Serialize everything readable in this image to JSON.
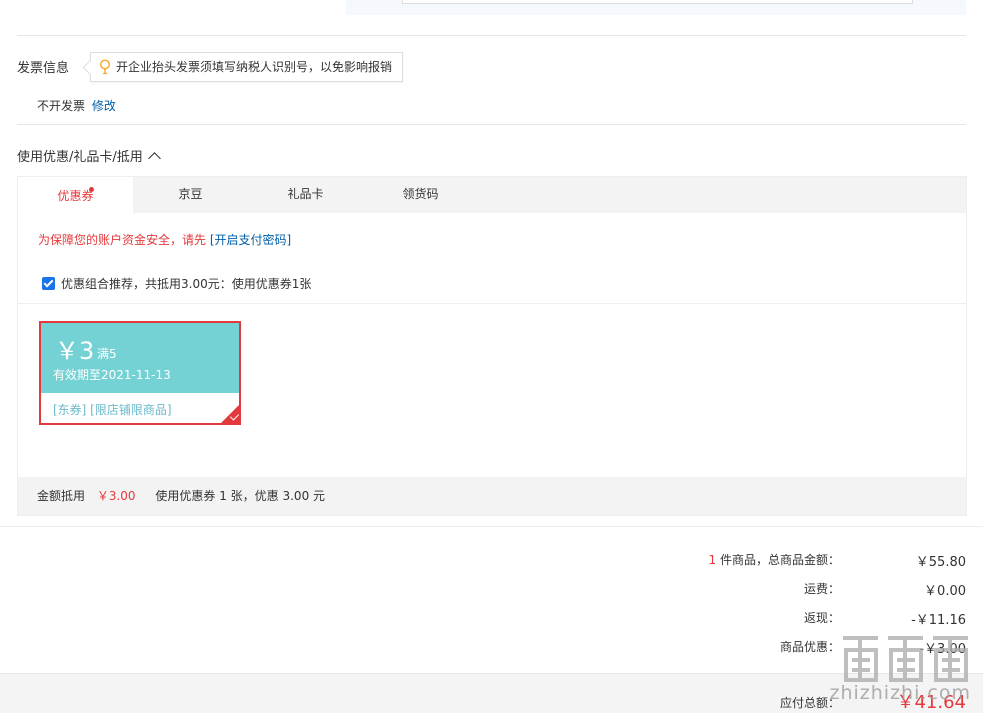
{
  "invoice": {
    "title": "发票信息",
    "tip": "开企业抬头发票须填写纳税人识别号，以免影响报销",
    "status": "不开发票",
    "edit_label": "修改"
  },
  "coupon_section": {
    "title": "使用优惠/礼品卡/抵用",
    "tabs": [
      {
        "label": "优惠券"
      },
      {
        "label": "京豆"
      },
      {
        "label": "礼品卡"
      },
      {
        "label": "领货码"
      }
    ],
    "security_tip": "为保障您的账户资金安全，请先",
    "security_link": "[开启支付密码]",
    "combo_label": "优惠组合推荐，共抵用3.00元：使用优惠券1张",
    "coupon": {
      "amount": "￥3",
      "condition": "满5",
      "expiry": "有效期至2021-11-13",
      "tags": "[东券] [限店铺限商品]"
    },
    "footer": {
      "deduct_label": "金额抵用",
      "deduct_value": "￥3.00",
      "summary": "使用优惠券 1 张，优惠 3.00 元"
    }
  },
  "summary": {
    "item_count": "1",
    "items_label": "件商品，总商品金额：",
    "items_value": "￥55.80",
    "shipping_label": "运费：",
    "shipping_value": "￥0.00",
    "cashback_label": "返现：",
    "cashback_value": "-￥11.16",
    "discount_label": "商品优惠：",
    "discount_value": "-￥3.00",
    "total_label": "应付总额：",
    "total_value": "￥41.64"
  },
  "watermark": {
    "text": "zhizhizhi.com"
  },
  "colors": {
    "accent_red": "#e4393c",
    "link_blue": "#005ea7",
    "coupon_teal": "#74d2d4"
  }
}
